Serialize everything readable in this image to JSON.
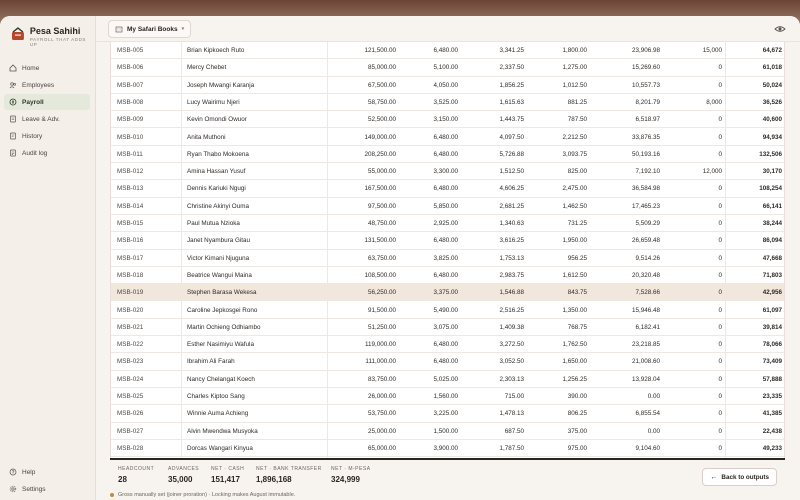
{
  "brand": {
    "name": "Pesa Sahihi",
    "tagline": "PAYROLL THAT ADDS UP"
  },
  "nav": {
    "items": [
      {
        "label": "Home",
        "icon": "home-icon",
        "active": false
      },
      {
        "label": "Employees",
        "icon": "users-icon",
        "active": false
      },
      {
        "label": "Payroll",
        "icon": "payroll-icon",
        "active": true
      },
      {
        "label": "Leave & Adv.",
        "icon": "document-icon",
        "active": false
      },
      {
        "label": "History",
        "icon": "history-icon",
        "active": false
      },
      {
        "label": "Audit log",
        "icon": "audit-icon",
        "active": false
      }
    ],
    "bottom": [
      {
        "label": "Help",
        "icon": "help-icon"
      },
      {
        "label": "Settings",
        "icon": "gear-icon"
      }
    ]
  },
  "topbar": {
    "org_name": "My Safari Books"
  },
  "colors": {
    "accent": "#2f3a28",
    "active_bg": "#e4e9dc",
    "highlight_row": "#f1e7dc",
    "note_dot": "#c8893a"
  },
  "table": {
    "rows": [
      [
        "MSB-005",
        "Brian Kipkoech Ruto",
        "121,500.00",
        "6,480.00",
        "3,341.25",
        "1,800.00",
        "23,906.98",
        "15,000",
        "64,672"
      ],
      [
        "MSB-006",
        "Mercy Chebet",
        "85,000.00",
        "5,100.00",
        "2,337.50",
        "1,275.00",
        "15,269.60",
        "0",
        "61,018"
      ],
      [
        "MSB-007",
        "Joseph Mwangi Karanja",
        "67,500.00",
        "4,050.00",
        "1,856.25",
        "1,012.50",
        "10,557.73",
        "0",
        "50,024"
      ],
      [
        "MSB-008",
        "Lucy Wairimu Njeri",
        "58,750.00",
        "3,525.00",
        "1,615.63",
        "881.25",
        "8,201.79",
        "8,000",
        "36,526"
      ],
      [
        "MSB-009",
        "Kevin Omondi Owuor",
        "52,500.00",
        "3,150.00",
        "1,443.75",
        "787.50",
        "6,518.97",
        "0",
        "40,600"
      ],
      [
        "MSB-010",
        "Anita Muthoni",
        "149,000.00",
        "6,480.00",
        "4,097.50",
        "2,212.50",
        "33,876.35",
        "0",
        "94,934"
      ],
      [
        "MSB-011",
        "Ryan Thabo Mokoena",
        "208,250.00",
        "6,480.00",
        "5,726.88",
        "3,093.75",
        "50,193.16",
        "0",
        "132,506"
      ],
      [
        "MSB-012",
        "Amina Hassan Yusuf",
        "55,000.00",
        "3,300.00",
        "1,512.50",
        "825.00",
        "7,192.10",
        "12,000",
        "30,170"
      ],
      [
        "MSB-013",
        "Dennis Kariuki Ngugi",
        "167,500.00",
        "6,480.00",
        "4,606.25",
        "2,475.00",
        "36,584.98",
        "0",
        "108,254"
      ],
      [
        "MSB-014",
        "Christine Akinyi Ouma",
        "97,500.00",
        "5,850.00",
        "2,681.25",
        "1,462.50",
        "17,465.23",
        "0",
        "66,141"
      ],
      [
        "MSB-015",
        "Paul Mutua Nzioka",
        "48,750.00",
        "2,925.00",
        "1,340.63",
        "731.25",
        "5,509.29",
        "0",
        "38,244"
      ],
      [
        "MSB-016",
        "Janet Nyambura Gitau",
        "131,500.00",
        "6,480.00",
        "3,616.25",
        "1,950.00",
        "26,659.48",
        "0",
        "86,094"
      ],
      [
        "MSB-017",
        "Victor Kimani Njuguna",
        "63,750.00",
        "3,825.00",
        "1,753.13",
        "956.25",
        "9,514.26",
        "0",
        "47,668"
      ],
      [
        "MSB-018",
        "Beatrice Wangui Maina",
        "108,500.00",
        "6,480.00",
        "2,983.75",
        "1,612.50",
        "20,320.48",
        "0",
        "71,803"
      ],
      [
        "MSB-019",
        "Stephen Barasa Wekesa",
        "56,250.00",
        "3,375.00",
        "1,546.88",
        "843.75",
        "7,528.66",
        "0",
        "42,956"
      ],
      [
        "MSB-020",
        "Caroline Jepkosgei Rono",
        "91,500.00",
        "5,490.00",
        "2,516.25",
        "1,350.00",
        "15,946.48",
        "0",
        "61,097"
      ],
      [
        "MSB-021",
        "Martin Ochieng Odhiambo",
        "51,250.00",
        "3,075.00",
        "1,409.38",
        "768.75",
        "6,182.41",
        "0",
        "39,814"
      ],
      [
        "MSB-022",
        "Esther Nasimiyu Wafula",
        "119,000.00",
        "6,480.00",
        "3,272.50",
        "1,762.50",
        "23,218.85",
        "0",
        "78,066"
      ],
      [
        "MSB-023",
        "Ibrahim Ali Farah",
        "111,000.00",
        "6,480.00",
        "3,052.50",
        "1,650.00",
        "21,008.60",
        "0",
        "73,409"
      ],
      [
        "MSB-024",
        "Nancy Chelangat Koech",
        "83,750.00",
        "5,025.00",
        "2,303.13",
        "1,256.25",
        "13,928.04",
        "0",
        "57,888"
      ],
      [
        "MSB-025",
        "Charles Kiptoo Sang",
        "26,000.00",
        "1,560.00",
        "715.00",
        "390.00",
        "0.00",
        "0",
        "23,335"
      ],
      [
        "MSB-026",
        "Winnie Auma Achieng",
        "53,750.00",
        "3,225.00",
        "1,478.13",
        "806.25",
        "6,855.54",
        "0",
        "41,385"
      ],
      [
        "MSB-027",
        "Alvin Mwendwa Musyoka",
        "25,000.00",
        "1,500.00",
        "687.50",
        "375.00",
        "0.00",
        "0",
        "22,438"
      ],
      [
        "MSB-028",
        "Dorcas Wangari Kinyua",
        "65,000.00",
        "3,900.00",
        "1,787.50",
        "975.00",
        "9,104.60",
        "0",
        "49,233"
      ]
    ],
    "highlighted_id": "MSB-019"
  },
  "summary": {
    "stats": [
      {
        "label": "HEADCOUNT",
        "value": "28"
      },
      {
        "label": "ADVANCES",
        "value": "35,000"
      },
      {
        "label": "NET · CASH",
        "value": "151,417"
      },
      {
        "label": "NET · BANK TRANSFER",
        "value": "1,896,168"
      },
      {
        "label": "NET · M-PESA",
        "value": "324,999"
      }
    ],
    "back_label": "Back to outputs",
    "note": "Gross manually set (joiner proration) · Locking makes August immutable."
  }
}
